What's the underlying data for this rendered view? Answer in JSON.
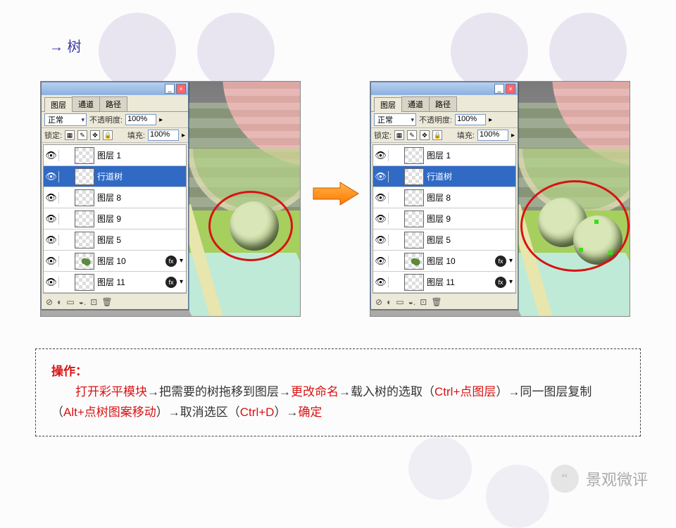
{
  "title": "→ 树",
  "layers_panel": {
    "tabs": [
      "图层",
      "通道",
      "路径"
    ],
    "blend_mode": "正常",
    "opacity_label": "不透明度:",
    "opacity_value": "100%",
    "lock_label": "锁定:",
    "fill_label": "填充:",
    "fill_value": "100%",
    "layers": [
      {
        "name": "图层 1",
        "selected": false,
        "thumb": "checker"
      },
      {
        "name": "行道树",
        "selected": true,
        "thumb": "checker"
      },
      {
        "name": "图层 8",
        "selected": false,
        "thumb": "checker"
      },
      {
        "name": "图层 9",
        "selected": false,
        "thumb": "checker"
      },
      {
        "name": "图层 5",
        "selected": false,
        "thumb": "checker"
      },
      {
        "name": "图层 10",
        "selected": false,
        "thumb": "green",
        "fx": true
      },
      {
        "name": "图层 11",
        "selected": false,
        "thumb": "checker",
        "fx": true
      }
    ],
    "footer_icons": [
      "⊘",
      "◐",
      "▭",
      "◒.",
      "⊡",
      "🗑"
    ]
  },
  "instruction": {
    "heading": "操作：",
    "parts": [
      {
        "red": true,
        "text": "打开彩平模块"
      },
      {
        "red": false,
        "text": "→把需要的树拖移到图层→"
      },
      {
        "red": true,
        "text": "更改命名"
      },
      {
        "red": false,
        "text": "→载入树的选取（"
      },
      {
        "red": true,
        "text": "Ctrl+点图层"
      },
      {
        "red": false,
        "text": "）→同一图层复制（"
      },
      {
        "red": true,
        "text": "Alt+点树图案移动"
      },
      {
        "red": false,
        "text": "）→取消选区（"
      },
      {
        "red": true,
        "text": "Ctrl+D"
      },
      {
        "red": false,
        "text": "）→"
      },
      {
        "red": true,
        "text": "确定"
      }
    ]
  },
  "watermark": "景观微评"
}
